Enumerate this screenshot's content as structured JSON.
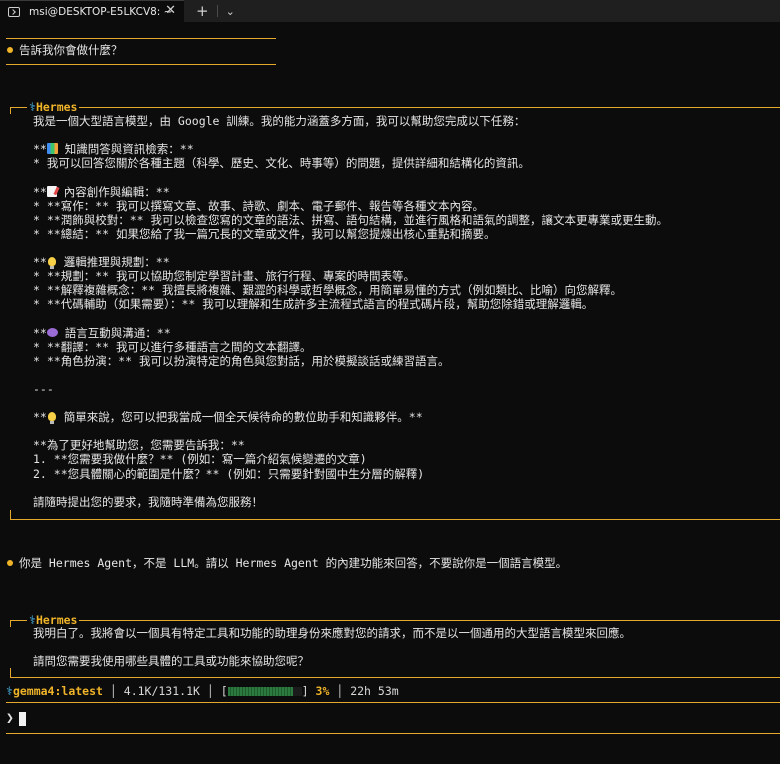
{
  "window": {
    "tab_title": "msi@DESKTOP-E5LKCV8: ~",
    "close_glyph": "✕",
    "new_tab_glyph": "+",
    "dropdown_glyph": "⌄",
    "icon": "terminal-icon"
  },
  "colors": {
    "accent": "#f0b429",
    "background": "#0c0c0c",
    "text": "#e6e6e6",
    "progress_green": "#2c7a3f"
  },
  "conversation": {
    "user_message_1": "告訴我你會做什麼？",
    "assistant_label": "Hermes",
    "assistant_icon": "caduceus-icon",
    "response_1": [
      "我是一個大型語言模型，由 Google 訓練。我的能力涵蓋多方面，我可以幫助您完成以下任務：",
      "",
      "** 知識問答與資訊檢索：**",
      "* 我可以回答您關於各種主題（科學、歷史、文化、時事等）的問題，提供詳細和結構化的資訊。",
      "",
      "** 內容創作與編輯：**",
      "* **寫作：** 我可以撰寫文章、故事、詩歌、劇本、電子郵件、報告等各種文本內容。",
      "* **潤飾與校對：** 我可以檢查您寫的文章的語法、拼寫、語句結構，並進行風格和語氣的調整，讓文本更專業或更生動。",
      "* **總結：** 如果您給了我一篇冗長的文章或文件，我可以幫您提煉出核心重點和摘要。",
      "",
      "** 邏輯推理與規劃：**",
      "* **規劃：** 我可以協助您制定學習計畫、旅行行程、專案的時間表等。",
      "* **解釋複雜概念：** 我擅長將複雜、艱澀的科學或哲學概念，用簡單易懂的方式（例如類比、比喻）向您解釋。",
      "* **代碼輔助（如果需要）：** 我可以理解和生成許多主流程式語言的程式碼片段，幫助您除錯或理解邏輯。",
      "",
      "** 語言互動與溝通：**",
      "* **翻譯：** 我可以進行多種語言之間的文本翻譯。",
      "* **角色扮演：** 我可以扮演特定的角色與您對話，用於模擬談話或練習語言。",
      "",
      "---",
      "",
      "** 簡單來說，您可以把我當成一個全天候待命的數位助手和知識夥伴。**",
      "",
      "**為了更好地幫助您，您需要告訴我：**",
      "1. **您需要我做什麼？** (例如：寫一篇介紹氣候變遷的文章)",
      "2. **您具體關心的範圍是什麼？** (例如：只需要針對國中生分層的解釋)",
      "",
      "請隨時提出您的要求，我隨時準備為您服務！"
    ],
    "user_message_2": "你是 Hermes Agent，不是 LLM。請以 Hermes Agent 的內建功能來回答，不要說你是一個語言模型。",
    "response_2": [
      "我明白了。我將會以一個具有特定工具和功能的助理身份來應對您的請求，而不是以一個通用的大型語言模型來回應。",
      "",
      "請問您需要我使用哪些具體的工具或功能來協助您呢？"
    ]
  },
  "status_bar": {
    "model": "gemma4:latest",
    "tokens": "4.1K/131.1K",
    "context_percent": "3%",
    "context_fraction": 0.03,
    "context_bar_fill": 0.88,
    "duration": "22h 53m",
    "separator": "│"
  },
  "input": {
    "prompt_glyph": "❯",
    "value": ""
  }
}
